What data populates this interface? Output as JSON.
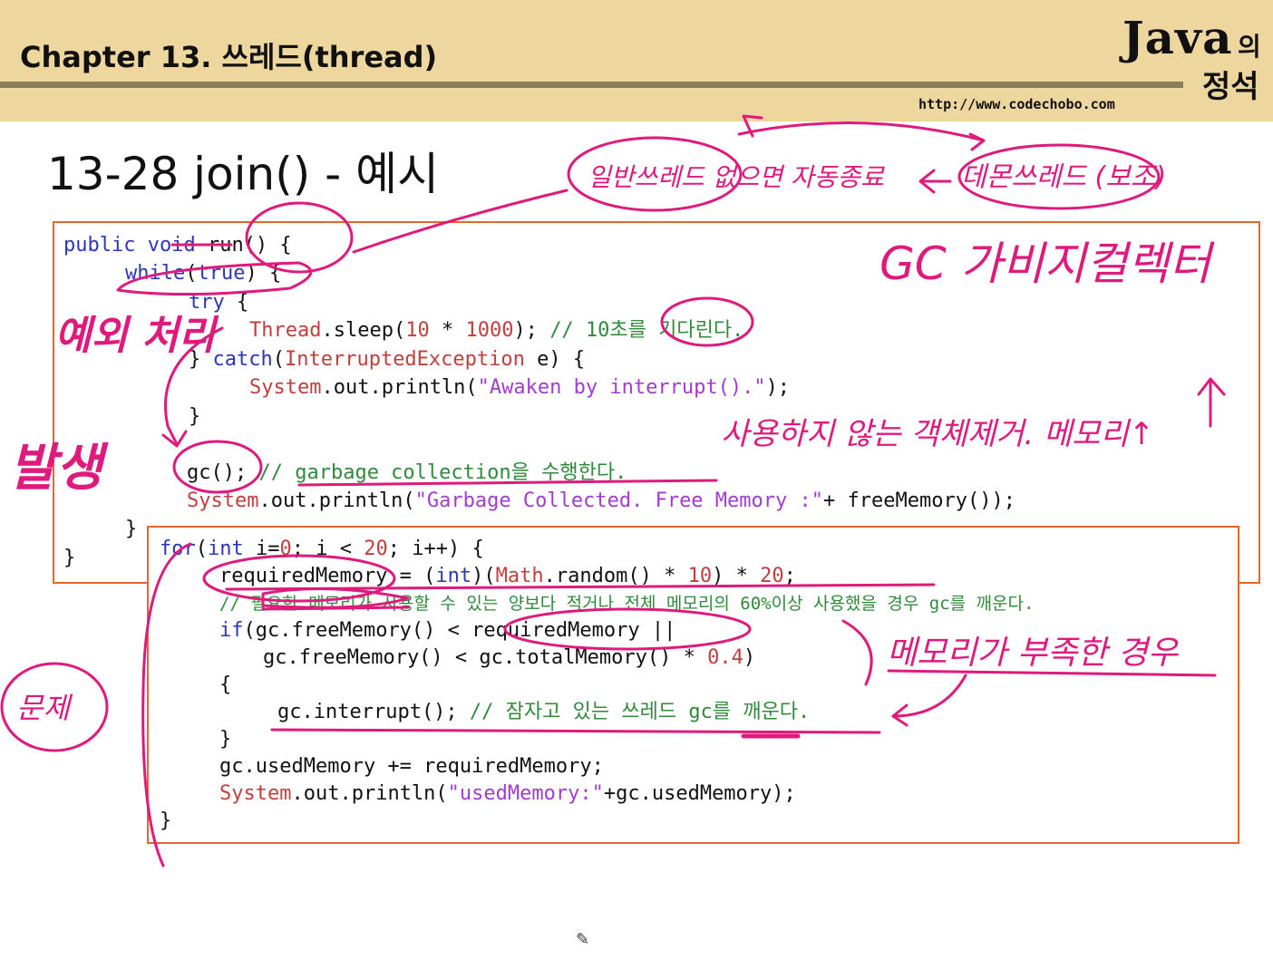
{
  "header": {
    "chapter_title": "Chapter 13. 쓰레드(thread)",
    "logo_java": "Java",
    "logo_ko1": "의",
    "logo_ko2": "정석",
    "url": "http://www.codechobo.com"
  },
  "slide": {
    "title": "13-28 join() - 예시"
  },
  "code1": {
    "l1_kw": "public void",
    "l1_rest": " run() {",
    "l2_kw": "while",
    "l2_a": "(",
    "l2_kw2": "true",
    "l2_b": ") {",
    "l3_kw": "try",
    "l3_b": " {",
    "l4_cls": "Thread",
    "l4_a": ".sleep(",
    "l4_n1": "10",
    "l4_b": " * ",
    "l4_n2": "1000",
    "l4_c": "); ",
    "l4_cm": "// 10초를 기다린다.",
    "l5_a": "} ",
    "l5_kw": "catch",
    "l5_b": "(",
    "l5_cls": "InterruptedException",
    "l5_c": " e) {",
    "l6_cls": "System",
    "l6_a": ".out.println(",
    "l6_str": "\"Awaken by interrupt().\"",
    "l6_b": ");",
    "l7": "}",
    "l8_a": "gc(); ",
    "l8_cm": "// garbage collection을 수행한다.",
    "l9_cls": "System",
    "l9_a": ".out.println(",
    "l9_str": "\"Garbage Collected. Free Memory :\"",
    "l9_b": "+ freeMemory());",
    "l10": "}",
    "l11": "}"
  },
  "code2": {
    "l1_kw": "for",
    "l1_a": "(",
    "l1_kw2": "int",
    "l1_b": " i=",
    "l1_n0": "0",
    "l1_c": "; i < ",
    "l1_n1": "20",
    "l1_d": "; i++) {",
    "l2_a": "requiredMemory = (",
    "l2_kw": "int",
    "l2_b": ")(",
    "l2_cls": "Math",
    "l2_c": ".random() * ",
    "l2_n1": "10",
    "l2_d": ") * ",
    "l2_n2": "20",
    "l2_e": ";",
    "l3_cm": "// 필요한 메모리가 사용할 수 있는 양보다 적거나 전체 메모리의 60%이상 사용했을 경우 gc를 깨운다.",
    "l4_kw": "if",
    "l4_a": "(gc.freeMemory() < requiredMemory ||",
    "l5_a": "gc.freeMemory() < gc.totalMemory() * ",
    "l5_n": "0.4",
    "l5_b": ")",
    "l6": "{",
    "l7_a": "gc.interrupt(); ",
    "l7_cm": "// 잠자고 있는 쓰레드 gc를 깨운다.",
    "l8": "}",
    "l9": "gc.usedMemory += requiredMemory;",
    "l10_cls": "System",
    "l10_a": ".out.println(",
    "l10_str": "\"usedMemory:\"",
    "l10_b": "+gc.usedMemory);",
    "l11": "}"
  },
  "annotations": {
    "a1": "일반쓰레드 없으면 자동종료",
    "a2": "데몬쓰레드 (보조)",
    "a3": "GC 가비지컬렉터",
    "a4": "예외 처리",
    "a5": "발생",
    "a6": "사용하지 않는 객체제거. 메모리↑",
    "a7": "메모리가 부족한 경우",
    "a8": "문제"
  },
  "colors": {
    "header_bg": "#eed79f",
    "box_border": "#e8652e",
    "ink": "#e0197d"
  }
}
